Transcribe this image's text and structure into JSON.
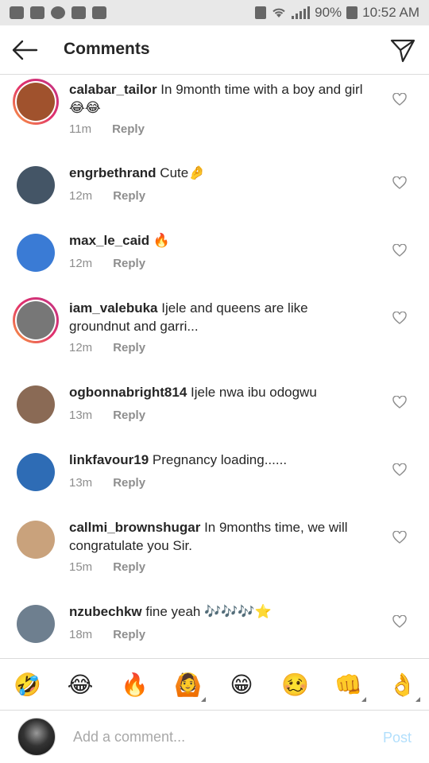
{
  "status_bar": {
    "battery": "90%",
    "time": "10:52 AM",
    "left_icons": [
      "gmail-icon",
      "message-icon",
      "whatsapp-icon",
      "gallery-icon",
      "mail-icon"
    ],
    "right_icons": [
      "vibrate-icon",
      "wifi-icon",
      "signal-icon",
      "battery-icon"
    ]
  },
  "header": {
    "title": "Comments"
  },
  "comments": [
    {
      "username": "calabar_tailor",
      "text": "In 9month time with a boy and girl😂😂",
      "time": "11m",
      "reply": "Reply",
      "has_story": true,
      "avatar_color": "#a0522d"
    },
    {
      "username": "engrbethrand",
      "text": "Cute🤌",
      "time": "12m",
      "reply": "Reply",
      "has_story": false,
      "avatar_color": "#445566"
    },
    {
      "username": "max_le_caid",
      "text": "🔥",
      "time": "12m",
      "reply": "Reply",
      "has_story": false,
      "avatar_color": "#3a7bd5"
    },
    {
      "username": "iam_valebuka",
      "text": "Ijele and queens are like groundnut and garri...",
      "time": "12m",
      "reply": "Reply",
      "has_story": true,
      "avatar_color": "#777777"
    },
    {
      "username": "ogbonnabright814",
      "text": "Ijele nwa ibu odogwu",
      "time": "13m",
      "reply": "Reply",
      "has_story": false,
      "avatar_color": "#8a6a55"
    },
    {
      "username": "linkfavour19",
      "text": "Pregnancy loading......",
      "time": "13m",
      "reply": "Reply",
      "has_story": false,
      "avatar_color": "#2e6cb5"
    },
    {
      "username": "callmi_brownshugar",
      "text": "In 9months time, we will congratulate you Sir.",
      "time": "15m",
      "reply": "Reply",
      "has_story": false,
      "avatar_color": "#c9a27c"
    },
    {
      "username": "nzubechkw",
      "text": "fine yeah 🎶🎶🎶⭐",
      "time": "18m",
      "reply": "Reply",
      "has_story": false,
      "avatar_color": "#6e7f8f"
    }
  ],
  "emoji_bar": [
    "🤣",
    "😂",
    "🔥",
    "🙆",
    "😁",
    "🥴",
    "👊",
    "👌"
  ],
  "composer": {
    "placeholder": "Add a comment...",
    "post_label": "Post"
  }
}
